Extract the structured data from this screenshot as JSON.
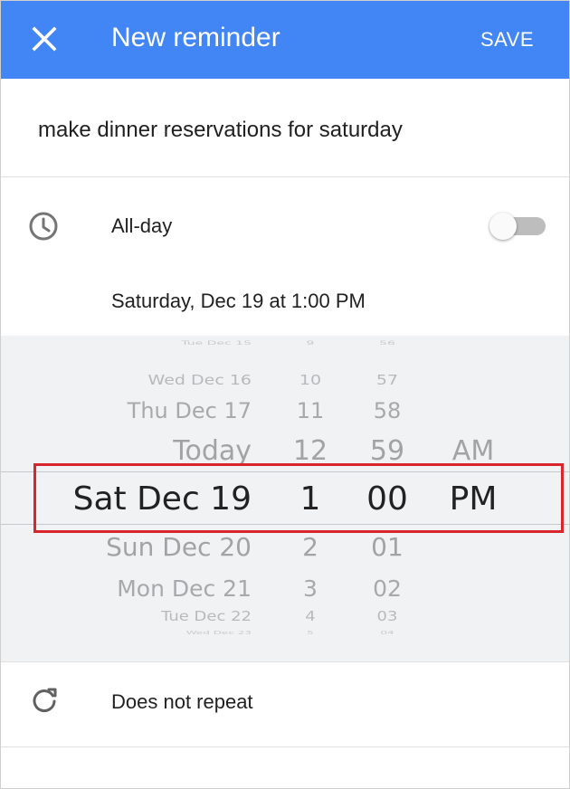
{
  "appbar": {
    "title": "New reminder",
    "save_label": "SAVE",
    "close_icon": "close-icon",
    "background": "#4285f4"
  },
  "reminder": {
    "title": "make dinner reservations for saturday"
  },
  "allday": {
    "label": "All-day",
    "enabled": false,
    "icon": "clock-icon"
  },
  "date_summary": "Saturday, Dec 19 at 1:00 PM",
  "picker": {
    "dates": [
      "Tue Dec 15",
      "Wed Dec 16",
      "Thu Dec 17",
      "Today",
      "Sat Dec 19",
      "Sun Dec 20",
      "Mon Dec 21",
      "Tue Dec 22",
      "Wed Dec 23"
    ],
    "hours": [
      "9",
      "10",
      "11",
      "12",
      "1",
      "2",
      "3",
      "4",
      "5"
    ],
    "minutes": [
      "56",
      "57",
      "58",
      "59",
      "00",
      "01",
      "02",
      "03",
      "04"
    ],
    "ampm": [
      "AM",
      "PM"
    ],
    "selected": {
      "date": "Sat Dec 19",
      "hour": "1",
      "minute": "00",
      "ampm": "PM"
    },
    "highlight_color": "#d8262c"
  },
  "repeat": {
    "label": "Does not repeat",
    "icon": "repeat-icon"
  }
}
